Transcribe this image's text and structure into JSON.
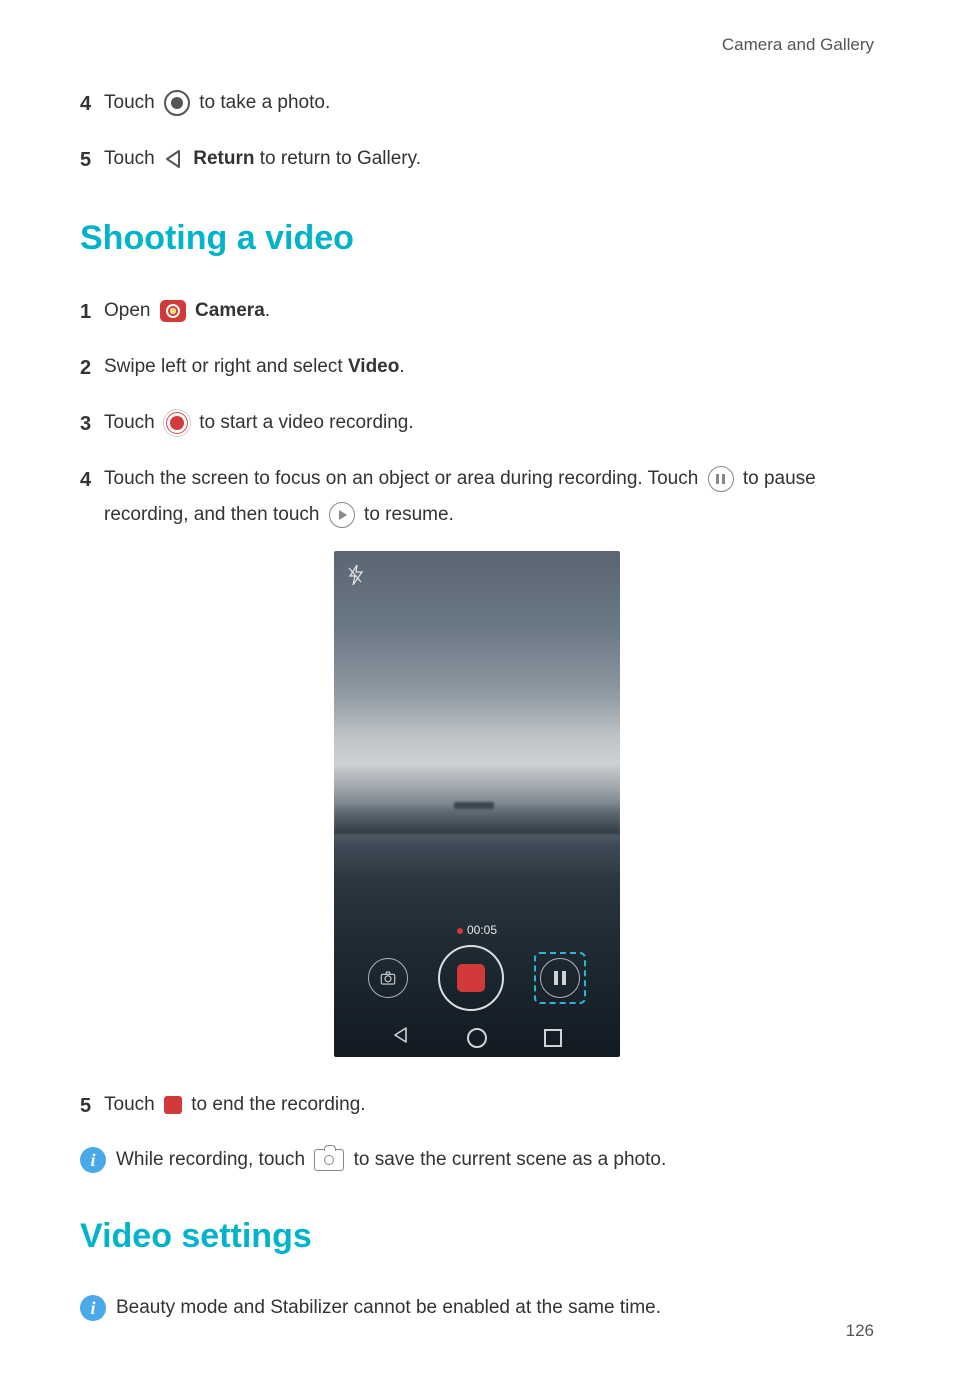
{
  "page": {
    "breadcrumb": "Camera and Gallery",
    "number": "126"
  },
  "intro_steps": {
    "s4": {
      "num": "4",
      "pre": "Touch ",
      "post": " to take a photo."
    },
    "s5": {
      "num": "5",
      "pre": "Touch ",
      "return_label": "Return",
      "post": " to return to Gallery."
    }
  },
  "section1": {
    "title": "Shooting a video",
    "s1": {
      "num": "1",
      "pre": "Open ",
      "camera_label": "Camera",
      "post": "."
    },
    "s2": {
      "num": "2",
      "pre": "Swipe left or right and select ",
      "video_label": "Video",
      "post": "."
    },
    "s3": {
      "num": "3",
      "pre": "Touch ",
      "post": " to start a video recording."
    },
    "s4": {
      "num": "4",
      "pre": "Touch the screen to focus on an object or area during recording. Touch ",
      "mid": " to pause recording, and then touch ",
      "post": " to resume."
    },
    "s5": {
      "num": "5",
      "pre": "Touch ",
      "post": " to end the recording."
    },
    "note": {
      "pre": "While recording, touch ",
      "post": " to save the current scene as a photo."
    },
    "phone": {
      "timer": "00:05"
    }
  },
  "section2": {
    "title": "Video settings",
    "note": "Beauty mode and Stabilizer cannot be enabled at the same time."
  }
}
